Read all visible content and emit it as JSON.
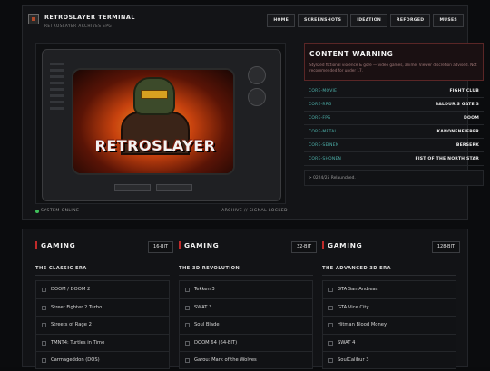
{
  "header": {
    "title": "RETROSLAYER TERMINAL",
    "subtitle": "RETROSLAYER ARCHIVES EPG",
    "nav": [
      "HOME",
      "SCREENSHOTS",
      "IDEATION",
      "REFORGED",
      "MUSES"
    ]
  },
  "tv": {
    "art_title": "RETROSLAYER",
    "status_left": "SYSTEM ONLINE",
    "status_right": "ARCHIVE // SIGNAL LOCKED"
  },
  "warning": {
    "title": "CONTENT WARNING",
    "text": "Stylized fictional violence & gore — video games, anime. Viewer discretion advised. Not recommended for under 17."
  },
  "core": [
    {
      "key": "CORE-MOVIE",
      "value": "FIGHT CLUB"
    },
    {
      "key": "CORE-RPG",
      "value": "BALDUR'S GATE 3"
    },
    {
      "key": "CORE-FPS",
      "value": "DOOM"
    },
    {
      "key": "CORE-METAL",
      "value": "KANONENFIEBER"
    },
    {
      "key": "CORE-SEINEN",
      "value": "BERSERK"
    },
    {
      "key": "CORE-SHONEN",
      "value": "FIST OF THE NORTH STAR"
    }
  ],
  "log": "> 0224/25 Relaunched.",
  "columns": [
    {
      "title": "GAMING",
      "badge": "16-BIT",
      "era": "THE CLASSIC ERA",
      "games": [
        "DOOM / DOOM 2",
        "Street Fighter 2 Turbo",
        "Streets of Rage 2",
        "TMNT4: Turtles in Time",
        "Carmageddon (DOS)"
      ]
    },
    {
      "title": "GAMING",
      "badge": "32-BIT",
      "era": "THE 3D REVOLUTION",
      "games": [
        "Tekken 3",
        "SWAT 3",
        "Soul Blade",
        "DOOM 64 (64-BIT)",
        "Garou: Mark of the Wolves"
      ]
    },
    {
      "title": "GAMING",
      "badge": "128-BIT",
      "era": "THE ADVANCED 3D ERA",
      "games": [
        "GTA San Andreas",
        "GTA Vice City",
        "Hitman Blood Money",
        "SWAT 4",
        "SoulCalibur 3"
      ]
    }
  ],
  "colors": {
    "accent": "#c02a2a",
    "teal": "#4fb7b0",
    "online": "#3fbf5a"
  }
}
